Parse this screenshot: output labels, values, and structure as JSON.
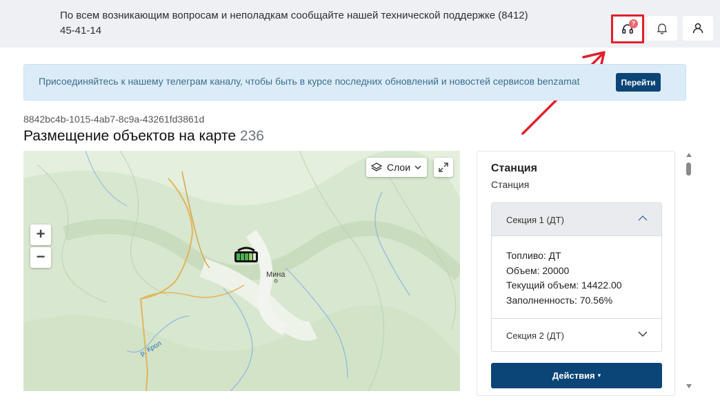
{
  "header": {
    "support_text": "По всем возникающим вопросам и неполадкам сообщайте нашей технической поддержке (8412) 45-41-14",
    "support_badge": "?",
    "icons": {
      "support": "headset-icon",
      "bell": "bell-icon",
      "user": "user-icon"
    }
  },
  "banner": {
    "text": "Присоединяйтесь к нашему телеграм каналу, чтобы быть в курсе последних обновлений и новостей сервисов benzamat",
    "button_label": "Перейти"
  },
  "page": {
    "object_id": "8842bc4b-1015-4ab7-8c9a-43261fd3861d",
    "title": "Размещение объектов на карте",
    "count": "236"
  },
  "map": {
    "zoom_in": "+",
    "zoom_out": "−",
    "layers_label": "Слои",
    "place_label": "Мина",
    "river_label": "р. Крол"
  },
  "station": {
    "title": "Станция",
    "subtitle": "Станция",
    "sections": [
      {
        "label": "Секция 1 (ДТ)",
        "expanded": true,
        "fuel": "Топливо: ДТ",
        "volume": "Объем: 20000",
        "current_volume": "Текущий объем: 14422.00",
        "fill": "Заполненность: 70.56%"
      },
      {
        "label": "Секция 2 (ДТ)",
        "expanded": false
      }
    ],
    "actions_label": "Действия"
  },
  "colors": {
    "primary": "#0b4577",
    "header_bg": "#eef0f4",
    "banner_bg": "#dbecf8",
    "annotation": "#e0202a"
  }
}
